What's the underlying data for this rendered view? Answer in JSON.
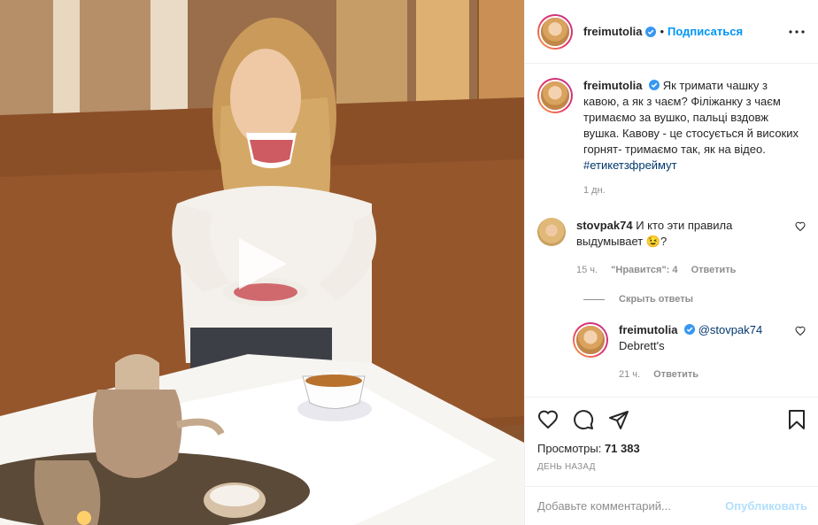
{
  "post": {
    "author": "freimutolia",
    "follow_label": "Подписаться",
    "caption_user": "freimutolia",
    "caption_text": "Як тримати чашку з кавою, а як з чаєм? Філіжанку з чаєм тримаємо за вушко, пальці вздовж вушка. Кавову - це стосується й високих горнят- тримаємо так, як на відео.",
    "caption_hashtag": "#етикетзфреймут",
    "caption_age": "1 дн."
  },
  "comments": [
    {
      "user": "stovpak74",
      "text": "И кто эти правила выдумывает 😉?",
      "time": "15 ч.",
      "likes": "\"Нравится\": 4",
      "reply_label": "Ответить"
    }
  ],
  "hide_replies_label": "Скрыть ответы",
  "reply": {
    "user": "freimutolia",
    "mention": "@stovpak74",
    "text": "Debrett's",
    "time": "21 ч.",
    "reply_label": "Ответить"
  },
  "stats": {
    "views_label": "Просмотры:",
    "views_count": "71 383",
    "date": "ДЕНЬ НАЗАД"
  },
  "composer": {
    "placeholder": "Добавьте комментарий...",
    "publish_label": "Опубликовать"
  },
  "icons": [
    "heart-icon",
    "comment-icon",
    "share-icon",
    "bookmark-icon",
    "more-icon",
    "play-icon",
    "verified-icon"
  ],
  "colors": {
    "link": "#0095f6",
    "publish_disabled": "#b2dffc",
    "muted": "#8e8e8e",
    "hashtag": "#00376b"
  }
}
